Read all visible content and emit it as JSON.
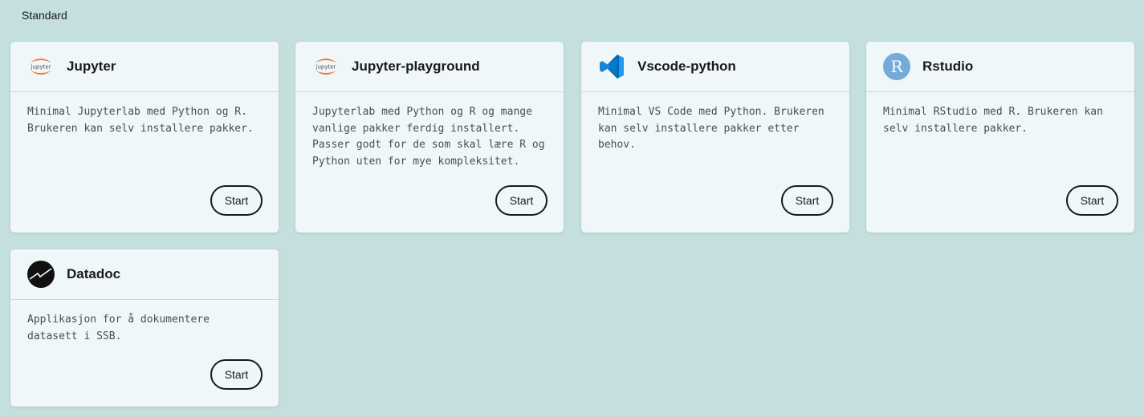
{
  "section": {
    "label": "Standard"
  },
  "cards": [
    {
      "title": "Jupyter",
      "icon": "jupyter-icon",
      "description": "Minimal Jupyterlab med Python og R. Brukeren kan selv installere pakker.",
      "button": "Start"
    },
    {
      "title": "Jupyter-playground",
      "icon": "jupyter-icon",
      "description": "Jupyterlab med Python og R og mange vanlige pakker ferdig installert. Passer godt for de som skal lære R og Python uten for mye kompleksitet.",
      "button": "Start"
    },
    {
      "title": "Vscode-python",
      "icon": "vscode-icon",
      "description": "Minimal VS Code med Python. Brukeren kan selv installere pakker etter behov.",
      "button": "Start"
    },
    {
      "title": "Rstudio",
      "icon": "rstudio-icon",
      "description": "Minimal RStudio med R. Brukeren kan selv installere pakker.",
      "button": "Start"
    },
    {
      "title": "Datadoc",
      "icon": "datadoc-icon",
      "description": "Applikasjon for å dokumentere datasett i SSB.",
      "button": "Start"
    }
  ],
  "colors": {
    "background": "#c4dfdd",
    "card": "#f0f7f8",
    "jupyter_orange": "#f37726",
    "vscode_blue": "#007acc",
    "rstudio_blue": "#75aadb"
  }
}
